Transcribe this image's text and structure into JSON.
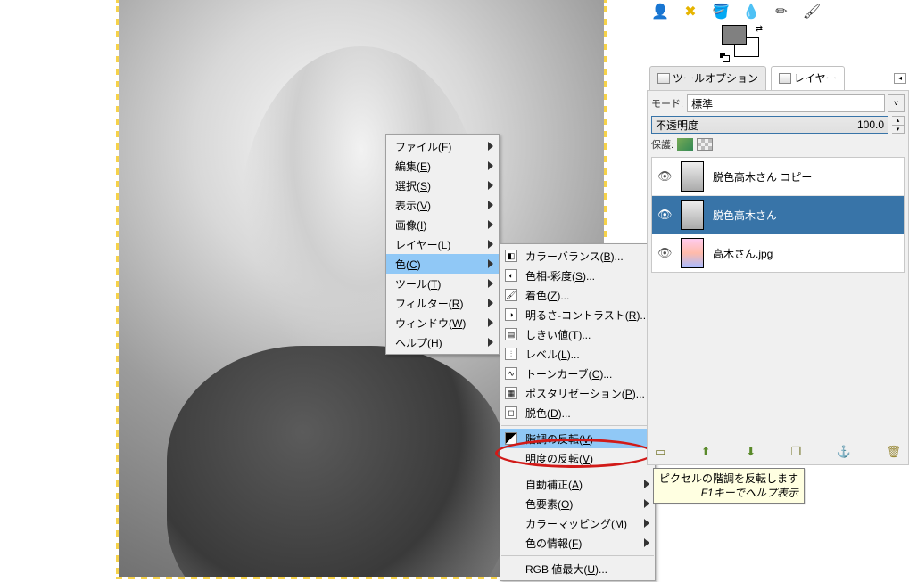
{
  "main_menu": {
    "items": [
      {
        "label": "ファイル",
        "key": "F",
        "sub": true
      },
      {
        "label": "編集",
        "key": "E",
        "sub": true
      },
      {
        "label": "選択",
        "key": "S",
        "sub": true
      },
      {
        "label": "表示",
        "key": "V",
        "sub": true
      },
      {
        "label": "画像",
        "key": "I",
        "sub": true
      },
      {
        "label": "レイヤー",
        "key": "L",
        "sub": true
      },
      {
        "label": "色",
        "key": "C",
        "sub": true,
        "highlight": true
      },
      {
        "label": "ツール",
        "key": "T",
        "sub": true
      },
      {
        "label": "フィルター",
        "key": "R",
        "sub": true
      },
      {
        "label": "ウィンドウ",
        "key": "W",
        "sub": true
      },
      {
        "label": "ヘルプ",
        "key": "H",
        "sub": true
      }
    ]
  },
  "color_submenu": {
    "groups": [
      [
        {
          "label": "カラーバランス",
          "key": "B",
          "dots": true,
          "icon": "balance"
        },
        {
          "label": "色相-彩度",
          "key": "S",
          "dots": true,
          "icon": "hue"
        },
        {
          "label": "着色",
          "key": "Z",
          "dots": true,
          "icon": "colorize"
        },
        {
          "label": "明るさ-コントラスト",
          "key": "R",
          "dots": true,
          "icon": "bc"
        },
        {
          "label": "しきい値",
          "key": "T",
          "dots": true,
          "icon": "thresh"
        },
        {
          "label": "レベル",
          "key": "L",
          "dots": true,
          "icon": "levels"
        },
        {
          "label": "トーンカーブ",
          "key": "C",
          "dots": true,
          "icon": "curves"
        },
        {
          "label": "ポスタリゼーション",
          "key": "P",
          "dots": true,
          "icon": "poster"
        },
        {
          "label": "脱色",
          "key": "D",
          "dots": true,
          "icon": "desat"
        }
      ],
      [
        {
          "label": "階調の反転",
          "key": "V",
          "highlight": true,
          "annot": true,
          "icon": "invert"
        },
        {
          "label": "明度の反転",
          "key": "V",
          "icon": "none"
        }
      ],
      [
        {
          "label": "自動補正",
          "key": "A",
          "sub": true
        },
        {
          "label": "色要素",
          "key": "O",
          "sub": true
        },
        {
          "label": "カラーマッピング",
          "key": "M",
          "sub": true
        },
        {
          "label": "色の情報",
          "key": "F",
          "sub": true
        }
      ],
      [
        {
          "label": "RGB 値最大",
          "key": "U",
          "dots": true
        }
      ]
    ]
  },
  "tooltip": {
    "line1": "ピクセルの階調を反転します",
    "line2": "F1キーでヘルプ表示"
  },
  "right": {
    "tabs": {
      "tool_options": "ツールオプション",
      "layers": "レイヤー"
    },
    "mode_label": "モード:",
    "mode_value": "標準",
    "opacity_label": "不透明度",
    "opacity_value": "100.0",
    "protect_label": "保護:",
    "layers_list": [
      {
        "name": "脱色高木さん コピー",
        "sel": false,
        "thumb": "g"
      },
      {
        "name": "脱色高木さん",
        "sel": true,
        "thumb": "g"
      },
      {
        "name": "高木さん.jpg",
        "sel": false,
        "thumb": "c"
      }
    ]
  }
}
